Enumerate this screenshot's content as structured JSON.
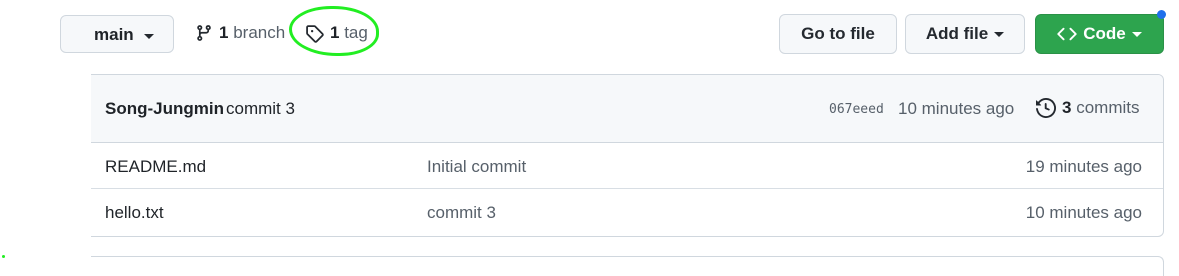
{
  "branch_selector": {
    "label": "main"
  },
  "branches": {
    "count": "1",
    "label": "branch"
  },
  "tags": {
    "count": "1",
    "label": "tag"
  },
  "actions": {
    "go_to_file": "Go to file",
    "add_file": "Add file",
    "code": "Code"
  },
  "latest_commit": {
    "author": "Song-Jungmin",
    "message": "commit 3",
    "hash": "067eeed",
    "time": "10 minutes ago",
    "commits_count": "3",
    "commits_label": "commits"
  },
  "files": [
    {
      "name": "README.md",
      "message": "Initial commit",
      "time": "19 minutes ago"
    },
    {
      "name": "hello.txt",
      "message": "commit 3",
      "time": "10 minutes ago"
    }
  ],
  "colors": {
    "code_button": "#2da44e",
    "annotation_circle": "#22ee22",
    "notification_dot": "#1f6feb"
  },
  "icons": [
    "git-branch-icon",
    "tag-icon",
    "code-icon",
    "history-icon",
    "caret-down-icon"
  ]
}
